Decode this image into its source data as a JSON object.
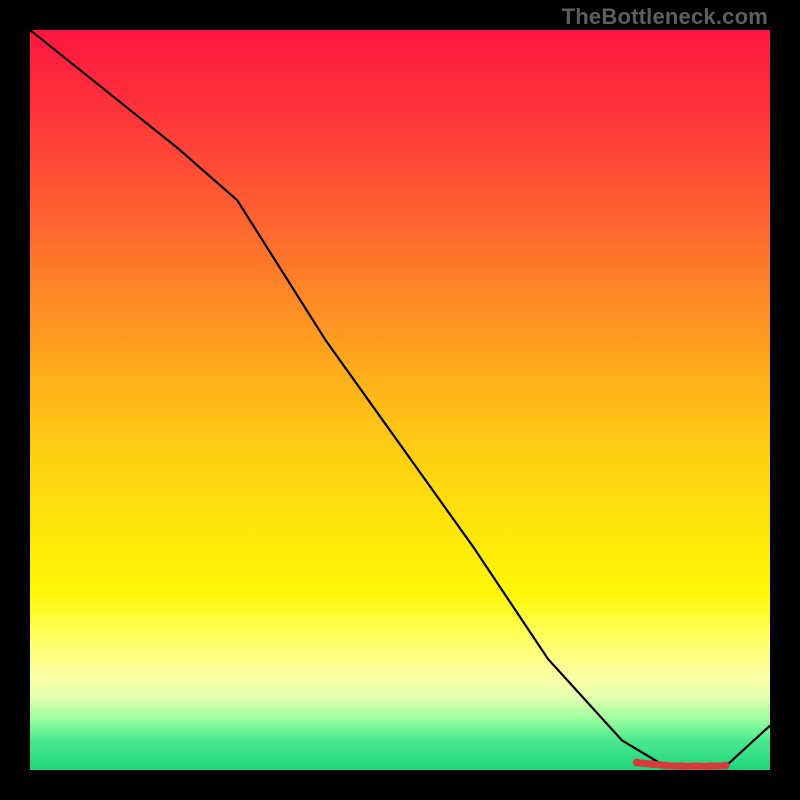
{
  "watermark": "TheBottleneck.com",
  "chart_data": {
    "type": "line",
    "title": "",
    "xlabel": "",
    "ylabel": "",
    "xlim": [
      0,
      100
    ],
    "ylim": [
      0,
      100
    ],
    "grid": false,
    "legend": false,
    "series": [
      {
        "name": "curve",
        "x": [
          0,
          10,
          20,
          28,
          40,
          50,
          60,
          70,
          80,
          85,
          90,
          94,
          100
        ],
        "y": [
          100,
          92,
          84,
          77,
          58,
          44,
          30,
          15,
          4,
          1,
          0.5,
          0.5,
          6
        ],
        "color": "#000000"
      }
    ],
    "markers": {
      "name": "highlight-band",
      "x": [
        82,
        84,
        86,
        88,
        90,
        92,
        94
      ],
      "y": [
        1.0,
        0.8,
        0.6,
        0.5,
        0.5,
        0.5,
        0.6
      ],
      "color": "#d63a3a"
    }
  }
}
